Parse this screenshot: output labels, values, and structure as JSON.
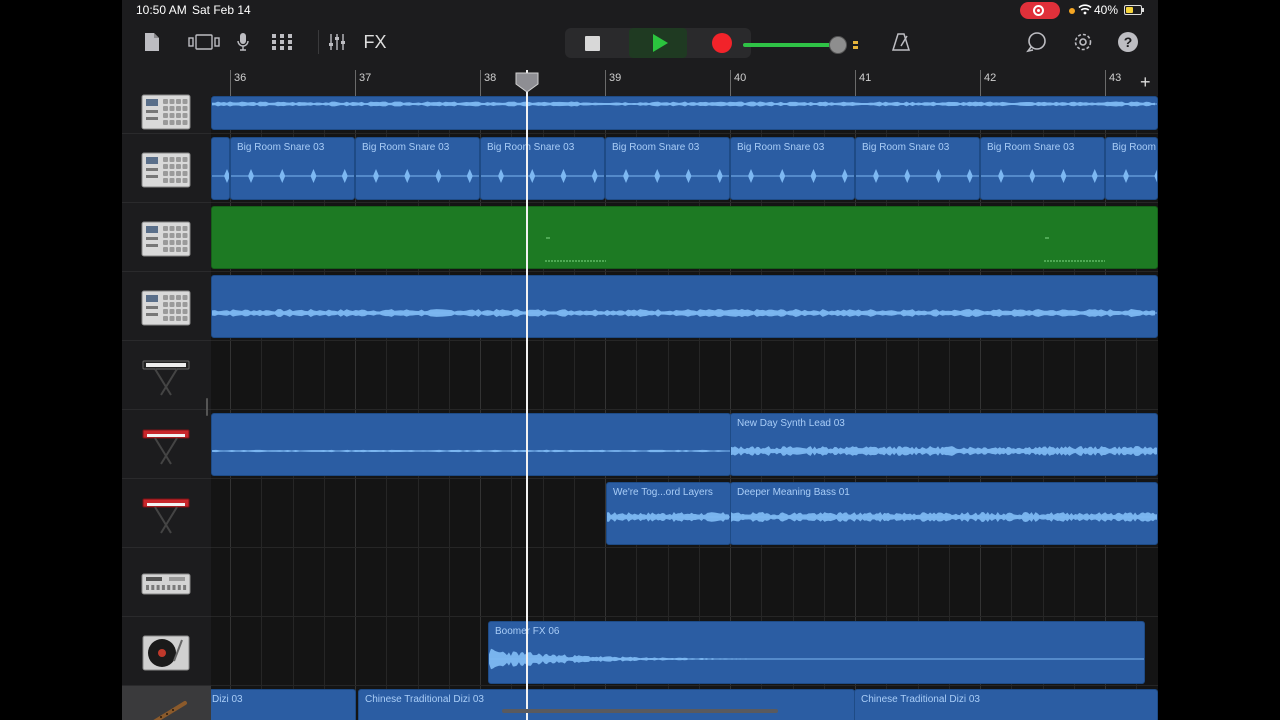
{
  "status": {
    "time": "10:50 AM",
    "date": "Sat Feb 14",
    "battery": "40%"
  },
  "toolbar": {
    "fx_label": "FX",
    "volume_level": 0.79
  },
  "colors": {
    "region_blue": "#2b5da3",
    "region_green": "#1d7a23",
    "waveform": "#7db8f2",
    "play": "#2bc43e",
    "record": "#f2232a"
  },
  "ruler": {
    "bars": [
      "36",
      "37",
      "38",
      "39",
      "40",
      "41",
      "42",
      "43"
    ]
  },
  "tracks": [
    {
      "instrument": "drum-machine-icon",
      "regions": []
    },
    {
      "instrument": "drum-machine-icon",
      "regions": [
        {
          "name": "Big Room Snare 03"
        },
        {
          "name": "Big Room Snare 03"
        },
        {
          "name": "Big Room Snare 03"
        },
        {
          "name": "Big Room Snare 03"
        },
        {
          "name": "Big Room Snare 03"
        },
        {
          "name": "Big Room Snare 03"
        },
        {
          "name": "Big Room Snare 03"
        },
        {
          "name": "Big Room"
        }
      ]
    },
    {
      "instrument": "drum-machine-icon",
      "regions": []
    },
    {
      "instrument": "drum-machine-icon",
      "regions": []
    },
    {
      "instrument": "keyboard-icon",
      "regions": []
    },
    {
      "instrument": "red-keyboard-icon",
      "regions": [
        {
          "name": "New Day Synth Lead 03"
        }
      ]
    },
    {
      "instrument": "red-keyboard-icon",
      "regions": [
        {
          "name": "We're Tog...ord Layers"
        },
        {
          "name": "Deeper Meaning Bass 01"
        }
      ]
    },
    {
      "instrument": "beat-sequencer-icon",
      "regions": []
    },
    {
      "instrument": "turntable-icon",
      "regions": [
        {
          "name": "Boomer FX 06"
        }
      ]
    },
    {
      "instrument": "dizi-flute-icon",
      "regions": [
        {
          "name": "Dizi 03"
        },
        {
          "name": "Chinese Traditional Dizi 03"
        },
        {
          "name": "Chinese Traditional Dizi 03"
        }
      ]
    }
  ]
}
